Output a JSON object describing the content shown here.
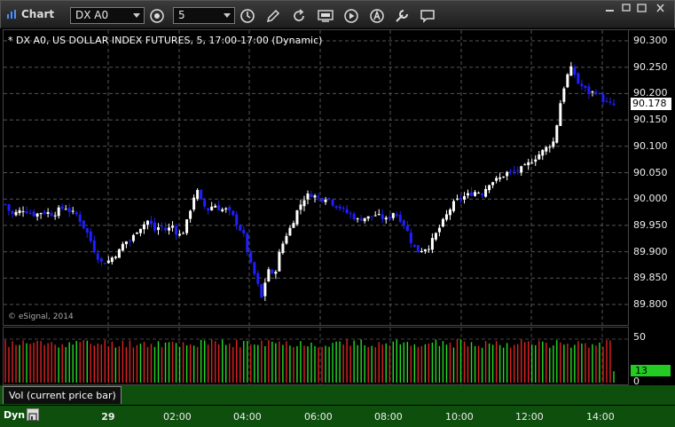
{
  "window": {
    "title": "Chart"
  },
  "toolbar": {
    "symbol": "DX A0",
    "interval": "5"
  },
  "chart": {
    "title": "* DX A0, US DOLLAR INDEX FUTURES, 5, 17:00-17:00 (Dynamic)",
    "copyright": "© eSignal, 2014",
    "last_price": "90.178",
    "price_ticks": [
      "90.300",
      "90.250",
      "90.200",
      "90.150",
      "90.100",
      "90.050",
      "90.000",
      "89.950",
      "89.900",
      "89.850",
      "89.800"
    ]
  },
  "volume": {
    "study_label": "Vol (current price bar)",
    "last_value": "13",
    "ticks": [
      "50",
      "0"
    ]
  },
  "time_axis": {
    "dyn_label": "Dyn",
    "ticks": [
      "29",
      "02:00",
      "04:00",
      "06:00",
      "08:00",
      "10:00",
      "12:00",
      "14:00"
    ]
  },
  "colors": {
    "up_candle": "#ffffff",
    "down_candle": "#1f1fff",
    "volume_up": "#22dd22",
    "volume_down": "#dd2222",
    "study_strip": "#0e4f0e"
  },
  "chart_data": {
    "type": "candlestick",
    "title": "* DX A0, US DOLLAR INDEX FUTURES, 5, 17:00-17:00 (Dynamic)",
    "ylim": [
      89.77,
      90.32
    ],
    "grid": true,
    "close_path": [
      89.99,
      89.97,
      89.975,
      89.98,
      89.975,
      89.97,
      89.975,
      89.975,
      89.97,
      89.98,
      89.985,
      89.975,
      89.97,
      89.95,
      89.93,
      89.9,
      89.88,
      89.88,
      89.89,
      89.9,
      89.92,
      89.92,
      89.94,
      89.95,
      89.96,
      89.94,
      89.95,
      89.94,
      89.95,
      89.93,
      89.94,
      89.98,
      90.02,
      89.99,
      89.98,
      89.99,
      89.98,
      89.98,
      89.97,
      89.95,
      89.93,
      89.88,
      89.85,
      89.81,
      89.87,
      89.85,
      89.9,
      89.93,
      89.95,
      89.98,
      90.0,
      90.01,
      90.005,
      90.0,
      90.005,
      89.99,
      89.985,
      89.975,
      89.97,
      89.96,
      89.965,
      89.965,
      89.97,
      89.965,
      89.96,
      89.975,
      89.965,
      89.95,
      89.92,
      89.9,
      89.905,
      89.91,
      89.93,
      89.95,
      89.97,
      89.99,
      90.0,
      90.005,
      90.01,
      90.015,
      90.01,
      90.03,
      90.035,
      90.04,
      90.05,
      90.05,
      90.055,
      90.06,
      90.07,
      90.08,
      90.09,
      90.1,
      90.11,
      90.18,
      90.23,
      90.25,
      90.22,
      90.21,
      90.2,
      90.205,
      90.19,
      90.18,
      90.178
    ],
    "volume": {
      "ylim": [
        0,
        55
      ],
      "last": 13
    }
  }
}
